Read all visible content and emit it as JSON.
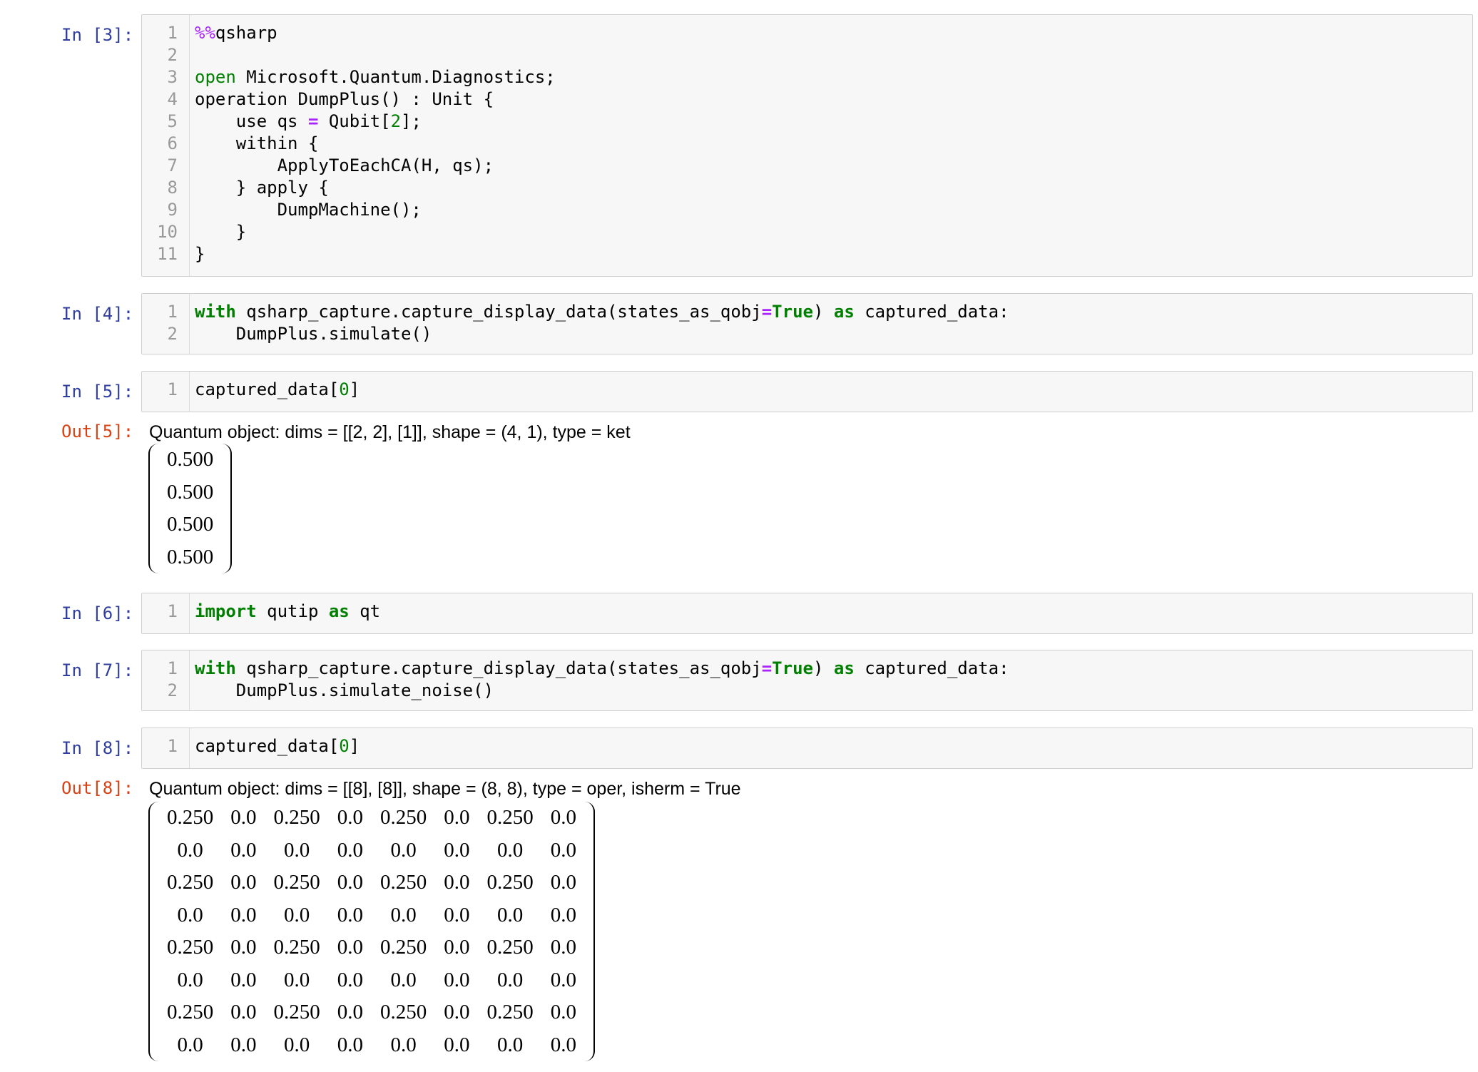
{
  "cells": {
    "in3": {
      "prompt": "In [3]:",
      "line_numbers": [
        "1",
        "2",
        "3",
        "4",
        "5",
        "6",
        "7",
        "8",
        "9",
        "10",
        "11"
      ]
    },
    "in4": {
      "prompt": "In [4]:",
      "line_numbers": [
        "1",
        "2"
      ]
    },
    "in5": {
      "prompt": "In [5]:",
      "line_numbers": [
        "1"
      ]
    },
    "out5": {
      "prompt": "Out[5]:",
      "header": "Quantum object: dims = [[2, 2], [1]], shape = (4, 1), type = ket",
      "matrix": [
        [
          "0.500"
        ],
        [
          "0.500"
        ],
        [
          "0.500"
        ],
        [
          "0.500"
        ]
      ]
    },
    "in6": {
      "prompt": "In [6]:",
      "line_numbers": [
        "1"
      ]
    },
    "in7": {
      "prompt": "In [7]:",
      "line_numbers": [
        "1",
        "2"
      ]
    },
    "in8": {
      "prompt": "In [8]:",
      "line_numbers": [
        "1"
      ]
    },
    "out8": {
      "prompt": "Out[8]:",
      "header": "Quantum object: dims = [[8], [8]], shape = (8, 8), type = oper, isherm = True",
      "matrix": [
        [
          "0.250",
          "0.0",
          "0.250",
          "0.0",
          "0.250",
          "0.0",
          "0.250",
          "0.0"
        ],
        [
          "0.0",
          "0.0",
          "0.0",
          "0.0",
          "0.0",
          "0.0",
          "0.0",
          "0.0"
        ],
        [
          "0.250",
          "0.0",
          "0.250",
          "0.0",
          "0.250",
          "0.0",
          "0.250",
          "0.0"
        ],
        [
          "0.0",
          "0.0",
          "0.0",
          "0.0",
          "0.0",
          "0.0",
          "0.0",
          "0.0"
        ],
        [
          "0.250",
          "0.0",
          "0.250",
          "0.0",
          "0.250",
          "0.0",
          "0.250",
          "0.0"
        ],
        [
          "0.0",
          "0.0",
          "0.0",
          "0.0",
          "0.0",
          "0.0",
          "0.0",
          "0.0"
        ],
        [
          "0.250",
          "0.0",
          "0.250",
          "0.0",
          "0.250",
          "0.0",
          "0.250",
          "0.0"
        ],
        [
          "0.0",
          "0.0",
          "0.0",
          "0.0",
          "0.0",
          "0.0",
          "0.0",
          "0.0"
        ]
      ]
    }
  },
  "code": {
    "in3": [
      [
        {
          "t": "%%",
          "c": "mg"
        },
        {
          "t": "qsharp",
          "c": ""
        }
      ],
      [],
      [
        {
          "t": "open",
          "c": "kw2"
        },
        {
          "t": " Microsoft.Quantum.Diagnostics;",
          "c": ""
        }
      ],
      [
        {
          "t": "operation DumpPlus() : Unit {",
          "c": ""
        }
      ],
      [
        {
          "t": "    use qs ",
          "c": ""
        },
        {
          "t": "=",
          "c": "op"
        },
        {
          "t": " Qubit[",
          "c": ""
        },
        {
          "t": "2",
          "c": "num"
        },
        {
          "t": "];",
          "c": ""
        }
      ],
      [
        {
          "t": "    within {",
          "c": ""
        }
      ],
      [
        {
          "t": "        ApplyToEachCA(H, qs);",
          "c": ""
        }
      ],
      [
        {
          "t": "    } apply {",
          "c": ""
        }
      ],
      [
        {
          "t": "        DumpMachine();",
          "c": ""
        }
      ],
      [
        {
          "t": "    }",
          "c": ""
        }
      ],
      [
        {
          "t": "}",
          "c": ""
        }
      ]
    ],
    "in4": [
      [
        {
          "t": "with",
          "c": "kw"
        },
        {
          "t": " qsharp_capture.capture_display_data(states_as_qobj",
          "c": ""
        },
        {
          "t": "=",
          "c": "op"
        },
        {
          "t": "True",
          "c": "kw"
        },
        {
          "t": ") ",
          "c": ""
        },
        {
          "t": "as",
          "c": "kw"
        },
        {
          "t": " captured_data:",
          "c": ""
        }
      ],
      [
        {
          "t": "    DumpPlus.simulate()",
          "c": ""
        }
      ]
    ],
    "in5": [
      [
        {
          "t": "captured_data[",
          "c": ""
        },
        {
          "t": "0",
          "c": "num"
        },
        {
          "t": "]",
          "c": ""
        }
      ]
    ],
    "in6": [
      [
        {
          "t": "import",
          "c": "kw"
        },
        {
          "t": " qutip ",
          "c": ""
        },
        {
          "t": "as",
          "c": "kw"
        },
        {
          "t": " qt",
          "c": ""
        }
      ]
    ],
    "in7": [
      [
        {
          "t": "with",
          "c": "kw"
        },
        {
          "t": " qsharp_capture.capture_display_data(states_as_qobj",
          "c": ""
        },
        {
          "t": "=",
          "c": "op"
        },
        {
          "t": "True",
          "c": "kw"
        },
        {
          "t": ") ",
          "c": ""
        },
        {
          "t": "as",
          "c": "kw"
        },
        {
          "t": " captured_data:",
          "c": ""
        }
      ],
      [
        {
          "t": "    DumpPlus.simulate_noise()",
          "c": ""
        }
      ]
    ],
    "in8": [
      [
        {
          "t": "captured_data[",
          "c": ""
        },
        {
          "t": "0",
          "c": "num"
        },
        {
          "t": "]",
          "c": ""
        }
      ]
    ]
  }
}
